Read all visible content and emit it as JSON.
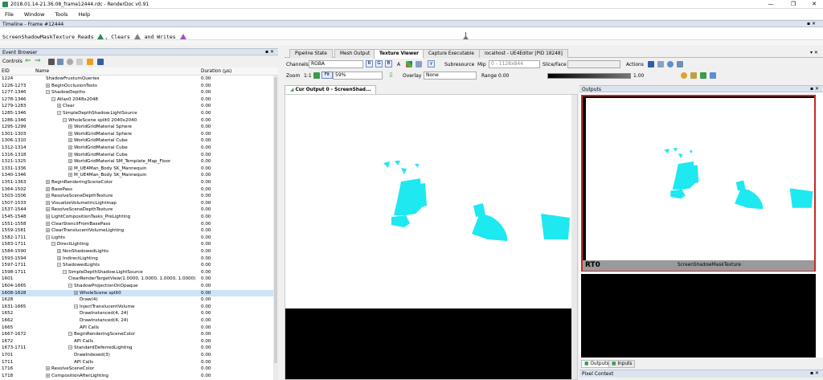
{
  "app": {
    "title": "2018.01.14-21.36.08_frame12444.rdc - RenderDoc v0.91",
    "window_buttons": [
      "—",
      "❐",
      "✕"
    ],
    "menu": [
      "File",
      "Window",
      "Tools",
      "Help"
    ]
  },
  "timeline": {
    "title": "Timeline - Frame #12444",
    "message_prefix": "ScreenShadowMaskTexture Reads",
    "message_clears": ", Clears",
    "message_writes": "and Writes",
    "read_color": "#2e8b57",
    "clear_color": "#808080",
    "write_color": "#9b59b6"
  },
  "event_browser": {
    "title": "Event Browser",
    "controls_label": "Controls",
    "columns": {
      "eid": "EID",
      "name": "Name",
      "duration": "Duration (µs)"
    },
    "rows": [
      {
        "eid": "1224",
        "name": "ShadowFrustumQueries",
        "dur": "0.00",
        "lvl": 1,
        "exp": "",
        "sel": false
      },
      {
        "eid": "1226-1273",
        "name": "BeginOcclusionTests",
        "dur": "0.00",
        "lvl": 1,
        "exp": "+",
        "sel": false
      },
      {
        "eid": "1277-1346",
        "name": "ShadowDepths",
        "dur": "0.00",
        "lvl": 1,
        "exp": "−",
        "sel": false
      },
      {
        "eid": "1278-1346",
        "name": "Atlas0 2048x2048",
        "dur": "0.00",
        "lvl": 2,
        "exp": "−",
        "sel": false
      },
      {
        "eid": "1279-1283",
        "name": "Clear",
        "dur": "0.00",
        "lvl": 3,
        "exp": "+",
        "sel": false
      },
      {
        "eid": "1285-1346",
        "name": "SimpleDepthShadow.LightSource",
        "dur": "0.00",
        "lvl": 3,
        "exp": "−",
        "sel": false
      },
      {
        "eid": "1286-1346",
        "name": "WholeScene split0 2040x2040",
        "dur": "0.00",
        "lvl": 4,
        "exp": "−",
        "sel": false
      },
      {
        "eid": "1295-1299",
        "name": "WorldGridMaterial Sphere",
        "dur": "0.00",
        "lvl": 5,
        "exp": "+",
        "sel": false
      },
      {
        "eid": "1301-1303",
        "name": "WorldGridMaterial Sphere",
        "dur": "0.00",
        "lvl": 5,
        "exp": "+",
        "sel": false
      },
      {
        "eid": "1306-1310",
        "name": "WorldGridMaterial Cube",
        "dur": "0.00",
        "lvl": 5,
        "exp": "+",
        "sel": false
      },
      {
        "eid": "1312-1314",
        "name": "WorldGridMaterial Cube",
        "dur": "0.00",
        "lvl": 5,
        "exp": "+",
        "sel": false
      },
      {
        "eid": "1316-1318",
        "name": "WorldGridMaterial Cube",
        "dur": "0.00",
        "lvl": 5,
        "exp": "+",
        "sel": false
      },
      {
        "eid": "1321-1325",
        "name": "WorldGridMaterial SM_Template_Map_Floor",
        "dur": "0.00",
        "lvl": 5,
        "exp": "+",
        "sel": false
      },
      {
        "eid": "1331-1336",
        "name": "M_UE4Man_Body SK_Mannequin",
        "dur": "0.00",
        "lvl": 5,
        "exp": "+",
        "sel": false
      },
      {
        "eid": "1340-1346",
        "name": "M_UE4Man_Body SK_Mannequin",
        "dur": "0.00",
        "lvl": 5,
        "exp": "+",
        "sel": false
      },
      {
        "eid": "1351-1363",
        "name": "BeginRenderingSceneColor",
        "dur": "0.00",
        "lvl": 1,
        "exp": "+",
        "sel": false
      },
      {
        "eid": "1364-1502",
        "name": "BasePass",
        "dur": "0.00",
        "lvl": 1,
        "exp": "+",
        "sel": false
      },
      {
        "eid": "1503-1506",
        "name": "ResolveSceneDepthTexture",
        "dur": "0.00",
        "lvl": 1,
        "exp": "+",
        "sel": false
      },
      {
        "eid": "1507-1533",
        "name": "VisualizeVolumetricLightmap",
        "dur": "0.00",
        "lvl": 1,
        "exp": "+",
        "sel": false
      },
      {
        "eid": "1537-1544",
        "name": "ResolveSceneDepthTexture",
        "dur": "0.00",
        "lvl": 1,
        "exp": "+",
        "sel": false
      },
      {
        "eid": "1545-1548",
        "name": "LightCompositionTasks_PreLighting",
        "dur": "0.00",
        "lvl": 1,
        "exp": "+",
        "sel": false
      },
      {
        "eid": "1551-1558",
        "name": "ClearStencilFromBasePass",
        "dur": "0.00",
        "lvl": 1,
        "exp": "+",
        "sel": false
      },
      {
        "eid": "1559-1581",
        "name": "ClearTranslucentVolumeLighting",
        "dur": "0.00",
        "lvl": 1,
        "exp": "+",
        "sel": false
      },
      {
        "eid": "1582-1711",
        "name": "Lights",
        "dur": "0.00",
        "lvl": 1,
        "exp": "−",
        "sel": false
      },
      {
        "eid": "1583-1711",
        "name": "DirectLighting",
        "dur": "0.00",
        "lvl": 2,
        "exp": "−",
        "sel": false
      },
      {
        "eid": "1584-1590",
        "name": "NonShadowedLights",
        "dur": "0.00",
        "lvl": 3,
        "exp": "+",
        "sel": false
      },
      {
        "eid": "1593-1594",
        "name": "IndirectLighting",
        "dur": "0.00",
        "lvl": 3,
        "exp": "+",
        "sel": false
      },
      {
        "eid": "1597-1711",
        "name": "ShadowedLights",
        "dur": "0.00",
        "lvl": 3,
        "exp": "−",
        "sel": false
      },
      {
        "eid": "1598-1711",
        "name": "SimpleDepthShadow.LightSource",
        "dur": "0.00",
        "lvl": 4,
        "exp": "−",
        "sel": false
      },
      {
        "eid": "1601",
        "name": "ClearRenderTargetView(1.0000, 1.0000, 1.0000, 1.0000)",
        "dur": "0.00",
        "lvl": 5,
        "exp": "",
        "sel": false
      },
      {
        "eid": "1604-1665",
        "name": "ShadowProjectionOnOpaque",
        "dur": "0.00",
        "lvl": 5,
        "exp": "−",
        "sel": false
      },
      {
        "eid": "1608-1628",
        "name": "WholeScene split0",
        "dur": "0.00",
        "lvl": 6,
        "exp": "+",
        "sel": true
      },
      {
        "eid": "1628",
        "name": "Draw(4)",
        "dur": "0.00",
        "lvl": 7,
        "exp": "",
        "sel": false
      },
      {
        "eid": "1631-1665",
        "name": "InjectTranslucentVolume",
        "dur": "0.00",
        "lvl": 6,
        "exp": "−",
        "sel": false
      },
      {
        "eid": "1652",
        "name": "DrawInstanced(4, 24)",
        "dur": "0.00",
        "lvl": 7,
        "exp": "",
        "sel": false
      },
      {
        "eid": "1662",
        "name": "DrawInstanced(4, 24)",
        "dur": "0.00",
        "lvl": 7,
        "exp": "",
        "sel": false
      },
      {
        "eid": "1665",
        "name": "API Calls",
        "dur": "0.00",
        "lvl": 7,
        "exp": "",
        "sel": false
      },
      {
        "eid": "1667-1672",
        "name": "BeginRenderingSceneColor",
        "dur": "0.00",
        "lvl": 5,
        "exp": "−",
        "sel": false
      },
      {
        "eid": "1672",
        "name": "API Calls",
        "dur": "0.00",
        "lvl": 6,
        "exp": "",
        "sel": false
      },
      {
        "eid": "1673-1711",
        "name": "StandardDeferredLighting",
        "dur": "0.00",
        "lvl": 5,
        "exp": "−",
        "sel": false
      },
      {
        "eid": "1701",
        "name": "DrawIndexed(3)",
        "dur": "0.00",
        "lvl": 6,
        "exp": "",
        "sel": false
      },
      {
        "eid": "1711",
        "name": "API Calls",
        "dur": "0.00",
        "lvl": 6,
        "exp": "",
        "sel": false
      },
      {
        "eid": "1716",
        "name": "ResolveSceneColor",
        "dur": "0.00",
        "lvl": 1,
        "exp": "+",
        "sel": false
      },
      {
        "eid": "1718",
        "name": "CompositionAfterLighting",
        "dur": "0.00",
        "lvl": 1,
        "exp": "+",
        "sel": false
      }
    ]
  },
  "main_tabs": [
    "Pipeline State",
    "Mesh Output",
    "Texture Viewer",
    "Capture Executable",
    "localhost - UE4Editor [PID 18248]"
  ],
  "active_tab": "Texture Viewer",
  "texture_toolbar": {
    "channels_label": "Channels",
    "channels_value": "RGBA",
    "channel_buttons": [
      "R",
      "G",
      "B",
      "A"
    ],
    "subresource_label": "Subresource",
    "mip_label": "Mip",
    "mip_value": "0 - 1128x844",
    "slice_label": "Slice/Face",
    "actions_label": "Actions",
    "zoom_label": "Zoom",
    "zoom_one": "1:1",
    "fit_label": "Fit",
    "zoom_value": "59%",
    "overlay_label": "Overlay",
    "overlay_value": "None",
    "range_label": "Range",
    "range_min": "0.00",
    "range_max": "1.00",
    "y_flip": "y"
  },
  "viewer": {
    "tab_label": "Cur Output 0 - ScreenShad...",
    "shape_color": "#1ee8f0"
  },
  "outputs": {
    "title": "Outputs",
    "rt_label": "RT0",
    "rt_name": "ScreenShadowMaskTexture",
    "tab_outputs": "Outputs",
    "tab_inputs": "Inputs",
    "pixel_context": "Pixel Context"
  }
}
